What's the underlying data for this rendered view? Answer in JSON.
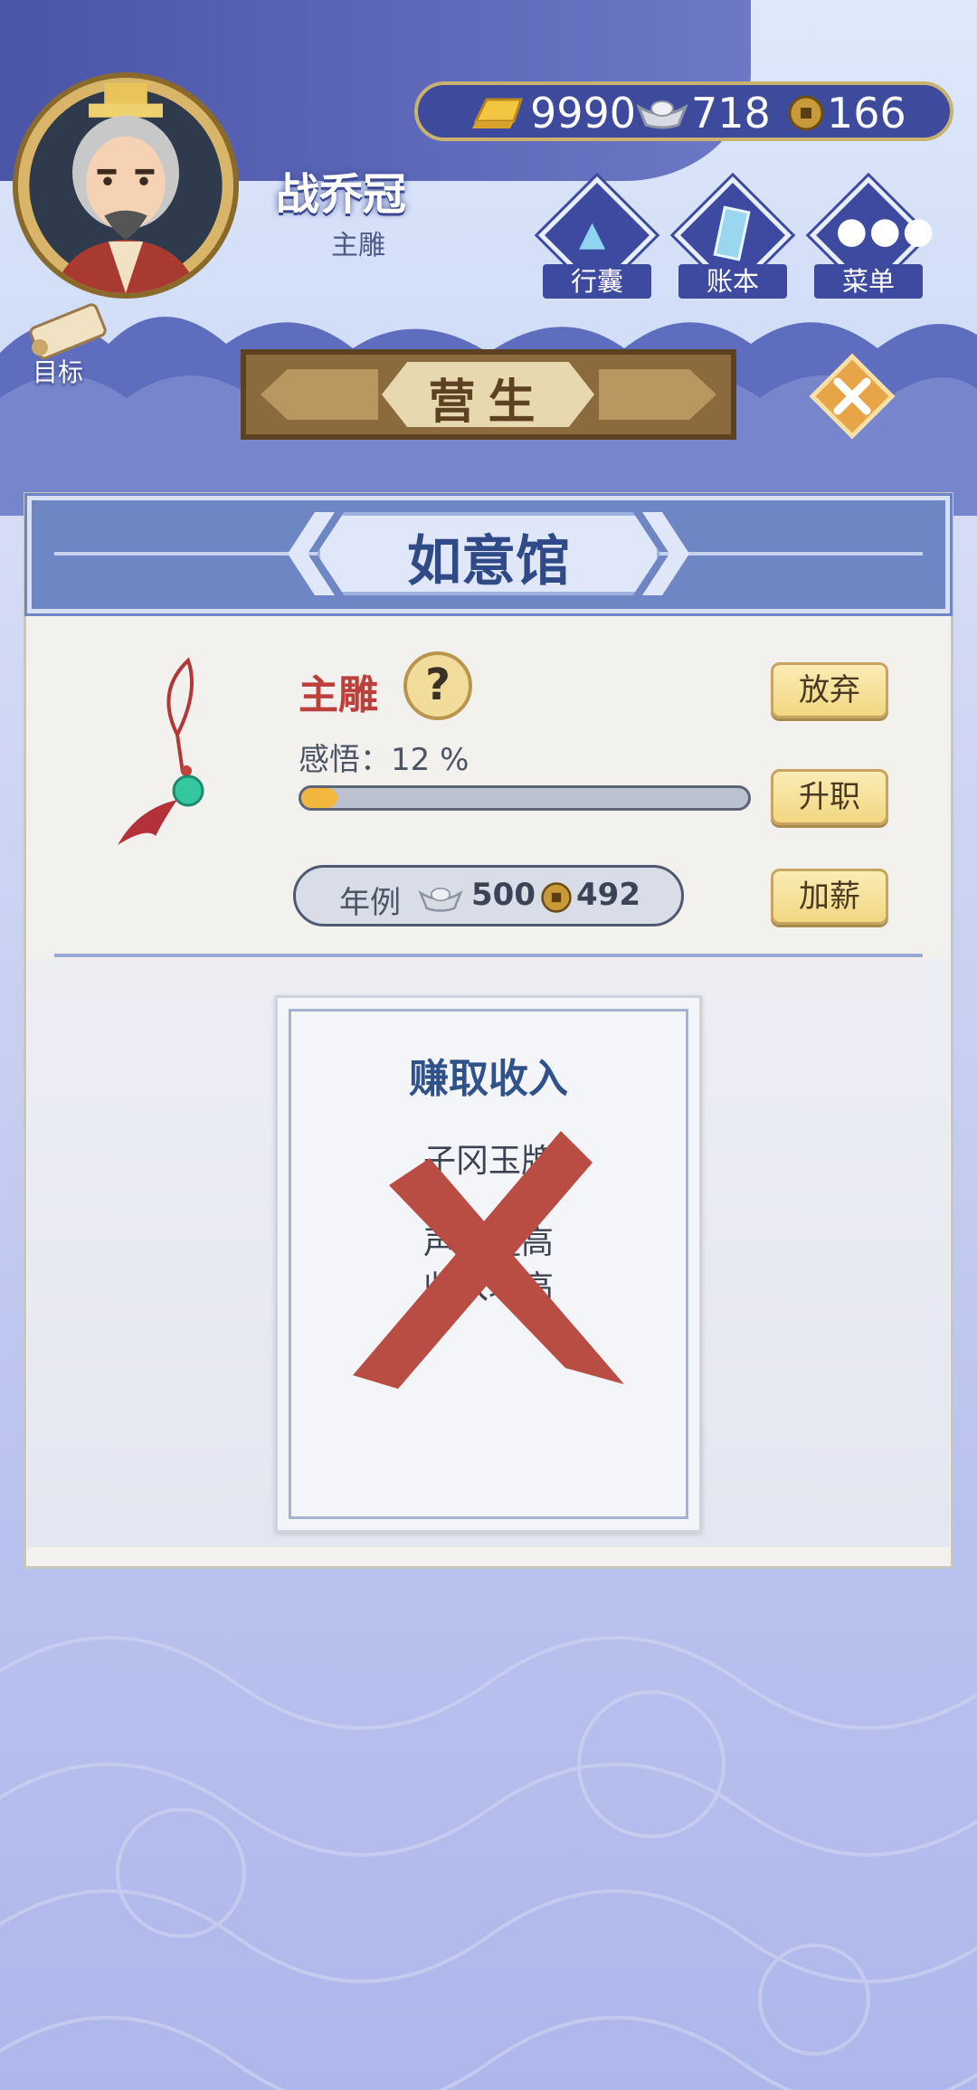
{
  "header": {
    "player_name": "战乔冠",
    "player_title": "主雕",
    "currency": {
      "gold": "9990",
      "silver": "718",
      "copper": "166"
    },
    "menu": [
      {
        "label": "行囊",
        "icon": "bag-icon"
      },
      {
        "label": "账本",
        "icon": "ledger-icon"
      },
      {
        "label": "菜单",
        "icon": "more-icon"
      }
    ],
    "goal_label": "目标"
  },
  "banner": {
    "title": "营生"
  },
  "panel": {
    "shop_name": "如意馆",
    "job_title": "主雕",
    "help_symbol": "?",
    "insight_label": "感悟：12 %",
    "insight_progress": 0.08,
    "salary_label": "年例",
    "salary_silver": "500",
    "salary_copper": "492",
    "buttons": {
      "quit": "放弃",
      "promote": "升职",
      "raise": "加薪"
    }
  },
  "task": {
    "title": "赚取收入",
    "lines": [
      "子冈玉牌",
      "声望提高",
      "收入增高"
    ],
    "status": "crossed-out"
  },
  "colors": {
    "accent_blue": "#3e4a9c",
    "title_red": "#bb3f3a",
    "cross_red": "#b94d44",
    "progress_fill": "#f3b73f"
  }
}
